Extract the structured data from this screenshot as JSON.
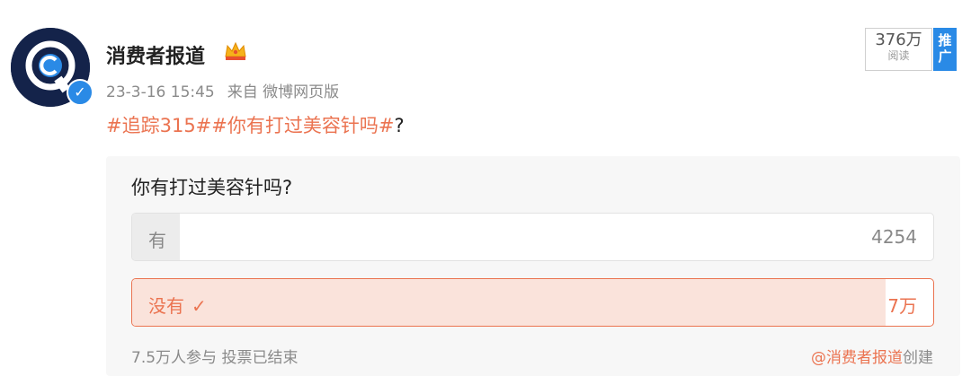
{
  "post": {
    "author": "消费者报道",
    "timestamp": "23-3-16 15:45",
    "source": "来自 微博网页版",
    "topics": [
      "#追踪315#",
      "#你有打过美容针吗#"
    ],
    "trailing_text": "?",
    "reads": {
      "value": "376万",
      "label": "阅读"
    },
    "promo_label": "推广"
  },
  "poll": {
    "question": "你有打过美容针吗?",
    "options": [
      {
        "label": "有",
        "count": "4254",
        "share": 0.06,
        "selected": false
      },
      {
        "label": "没有",
        "count": "7万",
        "share": 0.94,
        "selected": true
      }
    ],
    "participants": "7.5万人参与",
    "status": "投票已结束",
    "creator": "@消费者报道",
    "creator_suffix": "创建"
  },
  "colors": {
    "accent": "#eb7350",
    "verified": "#2a8ae6",
    "avatar_bg": "#14234a"
  },
  "icons": [
    "verified-badge-icon",
    "crown-icon",
    "checkmark-icon"
  ]
}
